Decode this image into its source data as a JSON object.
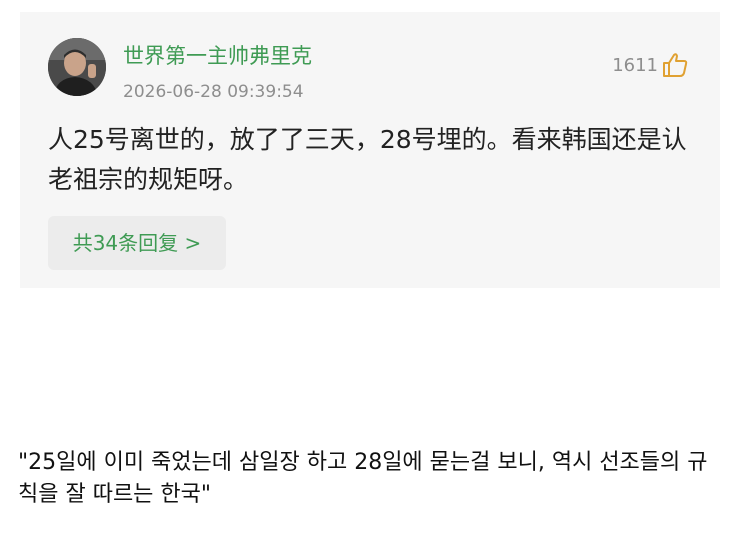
{
  "comment": {
    "username": "世界第一主帅弗里克",
    "timestamp": "2026-06-28 09:39:54",
    "like_count": "1611",
    "text": "人25号离世的，放了了三天，28号埋的。看来韩国还是认老祖宗的规矩呀。",
    "reply_label": "共34条回复 >",
    "accent_color": "#3f9b54"
  },
  "icons": {
    "like": "thumbs-up-icon",
    "avatar": "user-avatar"
  },
  "caption": {
    "text": "\"25일에 이미 죽었는데 삼일장 하고 28일에 묻는걸 보니, 역시 선조들의 규칙을 잘 따르는 한국\""
  }
}
